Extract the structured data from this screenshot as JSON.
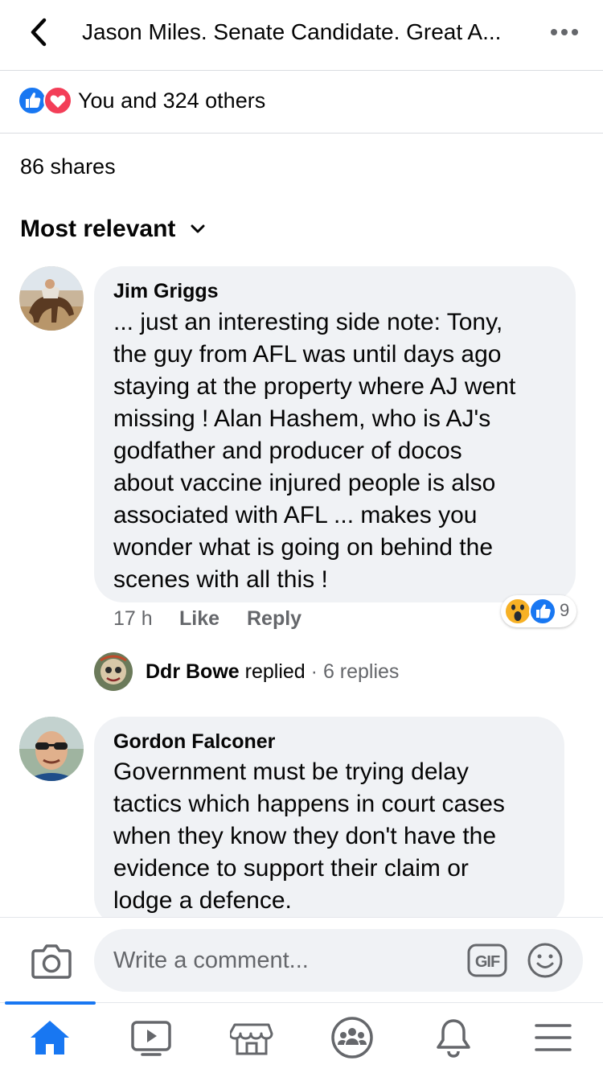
{
  "header": {
    "title": "Jason Miles. Senate Candidate. Great A..."
  },
  "reactions": {
    "summary": "You and 324 others"
  },
  "shares": "86 shares",
  "sort": {
    "label": "Most relevant"
  },
  "comments": [
    {
      "author": "Jim Griggs",
      "lines": [
        "... just an interesting side note: Tony,",
        "the guy from AFL was until days ago",
        "staying at the property where AJ went",
        "missing ! Alan Hashem, who is AJ's",
        "godfather and producer of docos",
        "about vaccine injured people is also",
        "associated with AFL ... makes you",
        "wonder what is going on behind the",
        "scenes with all this !"
      ],
      "time": "17 h",
      "like_label": "Like",
      "reply_label": "Reply",
      "reaction_count": "9",
      "replies": {
        "name": "Ddr Bowe",
        "verb": "replied",
        "separator": "·",
        "count": "6 replies"
      }
    },
    {
      "author": "Gordon Falconer",
      "lines": [
        "Government must be trying delay",
        "tactics which happens in court cases",
        "when they know they don't have the",
        "evidence to support their claim or",
        "lodge a defence."
      ]
    }
  ],
  "composer": {
    "placeholder": "Write a comment..."
  },
  "colors": {
    "accent": "#1877f2",
    "like_blue": "#1877f2",
    "love_red": "#f33e58",
    "bubble_bg": "#f0f2f5",
    "secondary_text": "#65676b"
  },
  "icons": {
    "back": "chevron-left-icon",
    "more": "more-dots-icon",
    "camera": "camera-icon",
    "gif": "gif-icon",
    "emoji": "emoji-icon",
    "tabs": [
      "home-icon",
      "video-icon",
      "marketplace-icon",
      "groups-icon",
      "bell-icon",
      "menu-icon"
    ]
  }
}
